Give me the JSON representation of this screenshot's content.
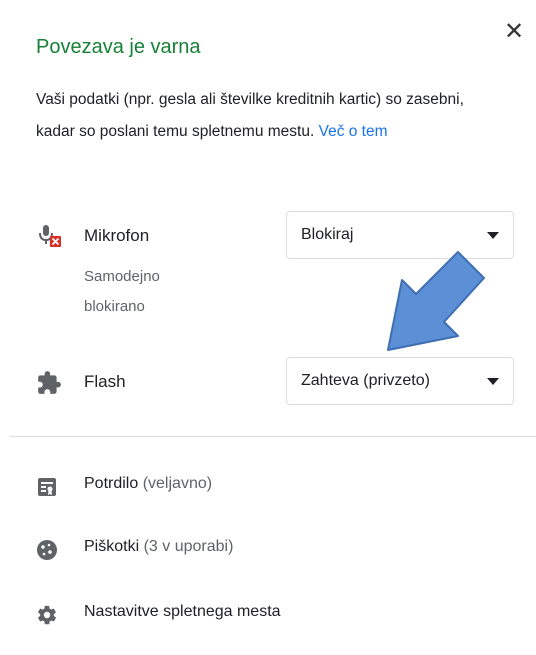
{
  "header": {
    "title": "Povezava je varna",
    "close_glyph": "✕",
    "description": "Vaši podatki (npr. gesla ali številke kreditnih kartic) so zasebni, kadar so poslani temu spletnemu mestu. ",
    "learn_more": "Več o tem"
  },
  "permissions": {
    "microphone": {
      "icon": "microphone-blocked-icon",
      "label": "Mikrofon",
      "sublabel": "Samodejno blokirano",
      "value": "Blokiraj"
    },
    "flash": {
      "icon": "puzzle-piece-icon",
      "label": "Flash",
      "value": "Zahteva (privzeto)"
    }
  },
  "links": {
    "certificate": {
      "icon": "certificate-icon",
      "label": "Potrdilo",
      "detail": "(veljavno)"
    },
    "cookies": {
      "icon": "cookie-icon",
      "label": "Piškotki",
      "detail": "(3 v uporabi)"
    },
    "site_settings": {
      "icon": "gear-icon",
      "label": "Nastavitve spletnega mesta"
    }
  },
  "colors": {
    "secure_green": "#188038",
    "link_blue": "#1a73e8",
    "annotation_arrow": "#5b8fd6",
    "blocked_red": "#d93025"
  }
}
